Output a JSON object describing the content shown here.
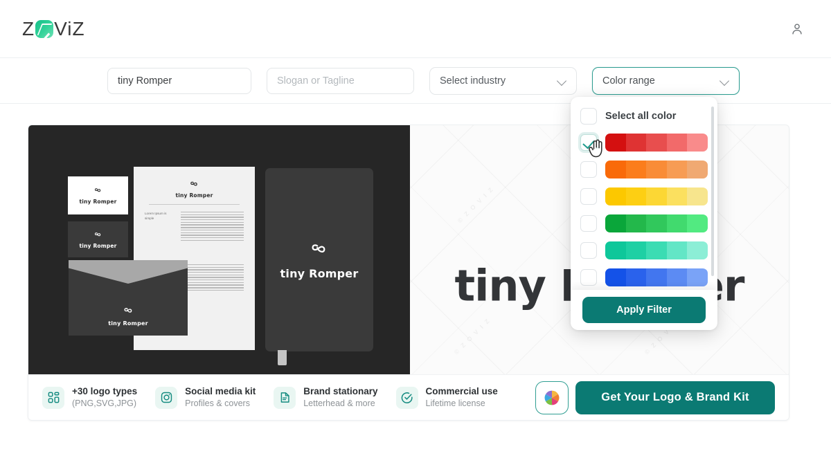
{
  "header": {
    "brand": {
      "left": "Z",
      "right": "ViZ",
      "mark_icon": "zoviz-logo-mark"
    },
    "account_icon": "user-account-icon"
  },
  "search": {
    "name_value": "tiny Romper",
    "slogan_placeholder": "Slogan or Tagline",
    "industry_label": "Select industry",
    "color_label": "Color range",
    "chevron_icon": "chevron-down-icon"
  },
  "preview": {
    "brand_name": "tiny Romper",
    "letterhead_caption": "Lorem Ipsum is simple",
    "watermark": "© Z O V I Z"
  },
  "features": [
    {
      "icon": "grid-squares-icon",
      "title": "+30 logo types",
      "subtitle": "(PNG,SVG,JPG)"
    },
    {
      "icon": "instagram-camera-icon",
      "title": "Social media kit",
      "subtitle": "Profiles & covers"
    },
    {
      "icon": "document-icon",
      "title": "Brand stationary",
      "subtitle": "Letterhead & more"
    },
    {
      "icon": "check-circle-icon",
      "title": "Commercial use",
      "subtitle": "Lifetime license"
    }
  ],
  "actions": {
    "color_wheel_icon": "color-wheel-icon",
    "cta_label": "Get Your Logo & Brand Kit"
  },
  "color_dropdown": {
    "select_all_label": "Select all color",
    "apply_label": "Apply Filter",
    "cursor_icon": "hand-pointer-cursor",
    "rows": [
      {
        "name": "red",
        "checked": true,
        "steps": [
          "#d41010",
          "#df3333",
          "#e84e4e",
          "#f26a6a",
          "#f98b8b"
        ]
      },
      {
        "name": "orange",
        "checked": false,
        "steps": [
          "#f96a09",
          "#fb7d1c",
          "#f98c37",
          "#f79c54",
          "#f0a972"
        ]
      },
      {
        "name": "yellow",
        "checked": false,
        "steps": [
          "#fcc800",
          "#fdcf13",
          "#fcd734",
          "#fbe05f",
          "#f7e58d"
        ]
      },
      {
        "name": "green",
        "checked": false,
        "steps": [
          "#0aa63a",
          "#23b84b",
          "#31c85c",
          "#41da6e",
          "#52ea81"
        ]
      },
      {
        "name": "teal",
        "checked": false,
        "steps": [
          "#0ec79a",
          "#1ed0a4",
          "#3bdcb3",
          "#63e6c6",
          "#8ceed6"
        ]
      },
      {
        "name": "blue",
        "checked": false,
        "steps": [
          "#1452e8",
          "#2a62ec",
          "#4276ef",
          "#5c8bf3",
          "#7aa3f7"
        ]
      }
    ],
    "accent": "#0b7a73",
    "scrollbar": true
  },
  "colors": {
    "teal": "#0b7a73",
    "teal_border": "#2f9e92",
    "mockup_bg": "#262626",
    "text_dark": "#333538"
  }
}
